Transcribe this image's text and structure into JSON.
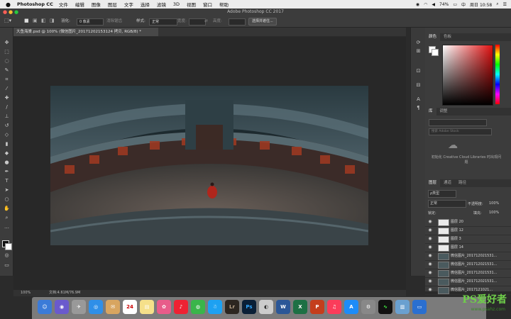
{
  "menubar": {
    "apple": "",
    "app": "Photoshop CC",
    "items": [
      "文件",
      "编辑",
      "图像",
      "图层",
      "文字",
      "选择",
      "滤镜",
      "3D",
      "视图",
      "窗口",
      "帮助"
    ],
    "battery": "74%",
    "clock": "周日 10:58"
  },
  "window": {
    "title": "Adobe Photoshop CC 2017"
  },
  "options": {
    "feather_label": "羽化:",
    "feather_value": "0 像素",
    "antialias": "消除锯齿",
    "style_label": "样式:",
    "style_value": "正常",
    "width_label": "宽度:",
    "height_label": "高度:",
    "select_mask": "选择并遮住..."
  },
  "document": {
    "tab": "大鱼海棠.psd @ 100% (微信图片_20171202153124 拷贝, RGB/8) *",
    "zoom": "100%",
    "doc_size": "文档:4.61M/76.9M"
  },
  "panels": {
    "color_tabs": [
      "颜色",
      "色板"
    ],
    "lib_tabs": [
      "库",
      "调整"
    ],
    "lib_search": "搜索 Adobe Stock",
    "lib_message": "初始化 Creative Cloud Libraries 时出现问题",
    "layer_tabs": [
      "图层",
      "通道",
      "路径"
    ],
    "kind": "ρ类型",
    "blend": "正常",
    "opacity_label": "不透明度:",
    "opacity": "100%",
    "lock_label": "锁定:",
    "fill_label": "填充:",
    "fill": "100%"
  },
  "layers": [
    {
      "name": "图层 20",
      "type": "blank"
    },
    {
      "name": "图层 12",
      "type": "blank"
    },
    {
      "name": "图层 3",
      "type": "blank"
    },
    {
      "name": "图层 14",
      "type": "blank"
    },
    {
      "name": "微信图片_201712021531...",
      "type": "img"
    },
    {
      "name": "微信图片_201712021531...",
      "type": "img"
    },
    {
      "name": "微信图片_201712021531...",
      "type": "img"
    },
    {
      "name": "微信图片_201712021531...",
      "type": "img"
    },
    {
      "name": "微信图片_2017121021...",
      "type": "img"
    }
  ],
  "dock": {
    "items": [
      "Lr",
      "Ps",
      "W",
      "X",
      "P",
      "24"
    ]
  },
  "watermark": {
    "text": "PS爱好者",
    "url": "www.psahz.com"
  },
  "colors": {
    "accent": "#2b2b2b",
    "dock": "#c0c0c0"
  }
}
